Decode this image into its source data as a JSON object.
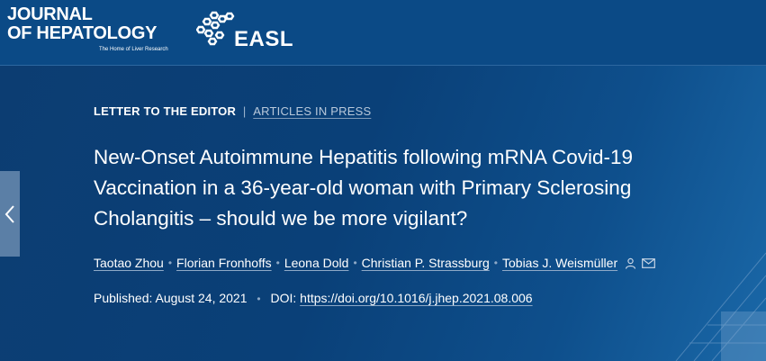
{
  "header": {
    "journal_line1": "JOURNAL",
    "journal_line2": "OF HEPATOLOGY",
    "journal_tagline": "The Home of Liver Research",
    "society_name": "EASL"
  },
  "article": {
    "type_label": "LETTER TO THE EDITOR",
    "separator": "|",
    "status_label": "ARTICLES IN PRESS",
    "title": "New-Onset Autoimmune Hepatitis following mRNA Covid-19 Vaccination in a 36-year-old woman with Primary Sclerosing Cholangitis – should we be more vigilant?",
    "authors": [
      {
        "name": "Taotao Zhou"
      },
      {
        "name": "Florian Fronhoffs"
      },
      {
        "name": "Leona Dold"
      },
      {
        "name": "Christian P. Strassburg"
      },
      {
        "name": "Tobias J. Weismüller"
      }
    ],
    "author_separator": "•",
    "published_label": "Published:",
    "published_date": "August 24, 2021",
    "doi_label": "DOI:",
    "doi_url": "https://doi.org/10.1016/j.jhep.2021.08.006"
  },
  "icons": {
    "back": "chevron-left-icon",
    "person": "person-icon",
    "email": "envelope-icon"
  },
  "colors": {
    "header_bg": "#0b4a86",
    "hero_bg": "#0c3d72",
    "accent": "#8ea9c7"
  }
}
